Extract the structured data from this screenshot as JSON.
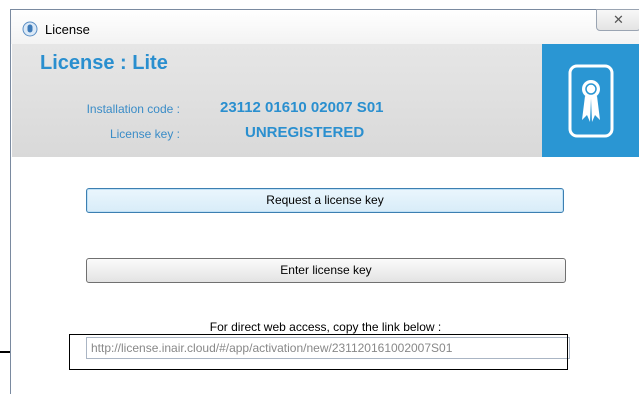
{
  "window": {
    "title": "License",
    "close_glyph": "✕"
  },
  "header": {
    "title": "License : Lite",
    "installation_code_label": "Installation code :",
    "installation_code": "23112 01610 02007 S01",
    "license_key_label": "License key :",
    "license_key": "UNREGISTERED",
    "badge_icon": "certificate-ribbon-icon"
  },
  "buttons": {
    "request_label": "Request a license key",
    "enter_label": "Enter license key"
  },
  "link": {
    "hint": "For direct web access, copy the link below :",
    "url": "http://license.inair.cloud/#/app/activation/new/231120161002007S01"
  },
  "colors": {
    "accent": "#2a8fcf",
    "badge_bg": "#2a96d3",
    "header_bg": "#e0e0e0"
  }
}
